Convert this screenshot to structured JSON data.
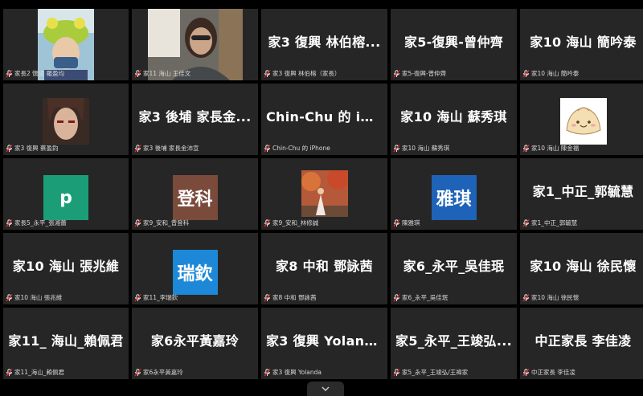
{
  "participants": [
    {
      "label": "家長2 懷語 羅盈均",
      "media": "video-kid"
    },
    {
      "label": "家11 海山 王佳文",
      "media": "video-girl"
    },
    {
      "name": "家3 復興 林伯榕...",
      "label": "家3 復興 林伯榕（家長）"
    },
    {
      "name": "家5-復興-曾仲齊",
      "label": "家5-復興-曾仲齊"
    },
    {
      "name": "家10 海山 簡吟泰",
      "label": "家10 海山 簡吟泰"
    },
    {
      "label": "家3 復興 蔡盈鈞",
      "media": "photo-anime"
    },
    {
      "name": "家3 後埔 家長金...",
      "label": "家3 後埔 家長金沛宣"
    },
    {
      "name": "Chin-Chu 的 iPh...",
      "label": "Chin-Chu 的 iPhone"
    },
    {
      "name": "家10 海山 蘇秀琪",
      "label": "家10 海山 蘇秀琪"
    },
    {
      "label": "家10 海山 陳金福",
      "media": "photo-bun"
    },
    {
      "label": "家長5_永平_張湘蕾",
      "avatar": "p",
      "avatar_color": "#1b9e77"
    },
    {
      "label": "家9_安和_曾登科",
      "avatar": "登科",
      "avatar_color": "#7a4a3a"
    },
    {
      "label": "家9_安和_林修誠",
      "media": "photo-autumn"
    },
    {
      "label": "陳雅琪",
      "avatar": "雅琪",
      "avatar_color": "#1e63b8"
    },
    {
      "name": "家1_中正_郭毓慧",
      "label": "家1_中正_郭毓慧"
    },
    {
      "name": "家10 海山 張兆維",
      "label": "家10 海山 張兆維"
    },
    {
      "label": "家11_李瑞欽",
      "avatar": "瑞欽",
      "avatar_color": "#1e88d8"
    },
    {
      "name": "家8 中和 鄧詠茜",
      "label": "家8 中和 鄧詠茜"
    },
    {
      "name": "家6_永平_吳佳珉",
      "label": "家6_永平_吳佳珉"
    },
    {
      "name": "家10 海山 徐民懷",
      "label": "家10 海山 徐民懷"
    },
    {
      "name": "家11_ 海山_賴佩君",
      "label": "家11_海山_賴佩君"
    },
    {
      "name": "家6永平黃嘉玲",
      "label": "家6永平黃嘉玲"
    },
    {
      "name": "家3 復興 Yolanda",
      "label": "家3 復興 Yolanda"
    },
    {
      "name": "家5_永平_王竣弘...",
      "label": "家5_永平_王竣弘/王禕家"
    },
    {
      "name": "中正家長 李佳凌",
      "label": "中正家長 李佳凌"
    }
  ],
  "icons": {
    "muted": "muted-mic-icon",
    "expand": "chevron-down-icon"
  },
  "colors": {
    "tile_bg": "#262626",
    "muted_red": "#e02828",
    "page_bg": "#000000"
  }
}
